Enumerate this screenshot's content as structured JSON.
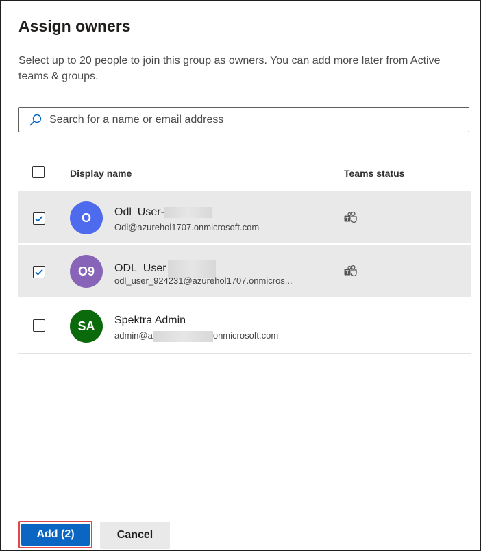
{
  "dialog": {
    "title": "Assign owners",
    "description": "Select up to 20 people to join this group as owners. You can add more later from Active teams & groups."
  },
  "search": {
    "placeholder": "Search for a name or email address",
    "value": ""
  },
  "table": {
    "columns": {
      "display_name": "Display name",
      "teams_status": "Teams status"
    },
    "header_checkbox_checked": false,
    "rows": [
      {
        "checked": true,
        "initials": "O",
        "avatar_color": "#4f6bed",
        "name": "Odl_User-",
        "email": "Odl@azurehol1707.onmicrosoft.com",
        "teams_icon": "teams-icon"
      },
      {
        "checked": true,
        "initials": "O9",
        "avatar_color": "#8764b8",
        "name": "ODL_User",
        "email": "odl_user_924231@azurehol1707.onmicros...",
        "teams_icon": "teams-icon"
      },
      {
        "checked": false,
        "initials": "SA",
        "avatar_color": "#0b6a0b",
        "name": "Spektra Admin",
        "email_prefix": "admin@a",
        "email_suffix": "onmicrosoft.com",
        "teams_icon": ""
      }
    ]
  },
  "footer": {
    "add_label": "Add (2)",
    "cancel_label": "Cancel"
  },
  "colors": {
    "primary": "#0a66c2",
    "highlight_border": "#e0474c",
    "selected_row": "#e9e9e9",
    "checkbox_check": "#0a66c2"
  }
}
